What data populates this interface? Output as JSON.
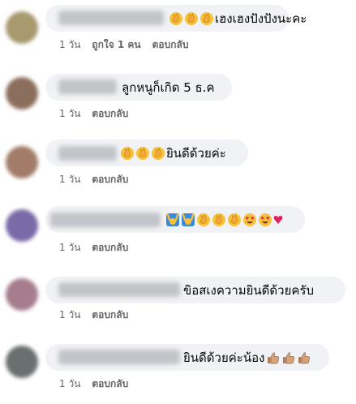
{
  "comments": [
    {
      "text": "เฮงเฮงปังปังนะคะ",
      "time": "1 วัน",
      "like_label": "ถูกใจ",
      "reaction_count": "1 คน",
      "reply_label": "ตอบกลับ",
      "emojis": [
        "clap-icon",
        "clap-icon",
        "clap-icon"
      ],
      "avatar_color": "#a89a6e"
    },
    {
      "text": "ลูกหนูก็เกิด 5 ธ.ค",
      "time": "1 วัน",
      "reply_label": "ตอบกลับ",
      "emojis": [],
      "avatar_color": "#8c6e5c"
    },
    {
      "text": "ยินดีด้วยค่ะ",
      "time": "1 วัน",
      "reply_label": "ตอบกลับ",
      "emojis": [
        "clap-icon",
        "clap-icon",
        "clap-icon"
      ],
      "avatar_color": "#a27c68"
    },
    {
      "text": "",
      "time": "1 วัน",
      "reply_label": "ตอบกลับ",
      "emojis": [
        "raising-hands-icon",
        "raising-hands-icon",
        "clap-icon",
        "clap-icon",
        "clap-icon",
        "heart-eyes-icon",
        "heart-eyes-icon",
        "heart-icon"
      ],
      "avatar_color": "#7b6aa8"
    },
    {
      "text": "ขิอสเงความยินดีด้วยครับ",
      "time": "1 วัน",
      "reply_label": "ตอบกลับ",
      "emojis": [],
      "avatar_color": "#a77d8e"
    },
    {
      "text": "ยินดีด้วยค่ะน้อง",
      "time": "1 วัน",
      "reply_label": "ตอบกลับ",
      "emojis": [
        "thumbs-up-icon",
        "thumbs-up-icon",
        "thumbs-up-icon"
      ],
      "avatar_color": "#6a6f70"
    }
  ],
  "colors": {
    "bubble": "#f0f2f5",
    "meta_text": "#65676b",
    "comment_text": "#050505",
    "clap_yellow": "#f7c23a",
    "thumb_skin": "#d4a17a",
    "raise_blue": "#3a8ad8"
  }
}
